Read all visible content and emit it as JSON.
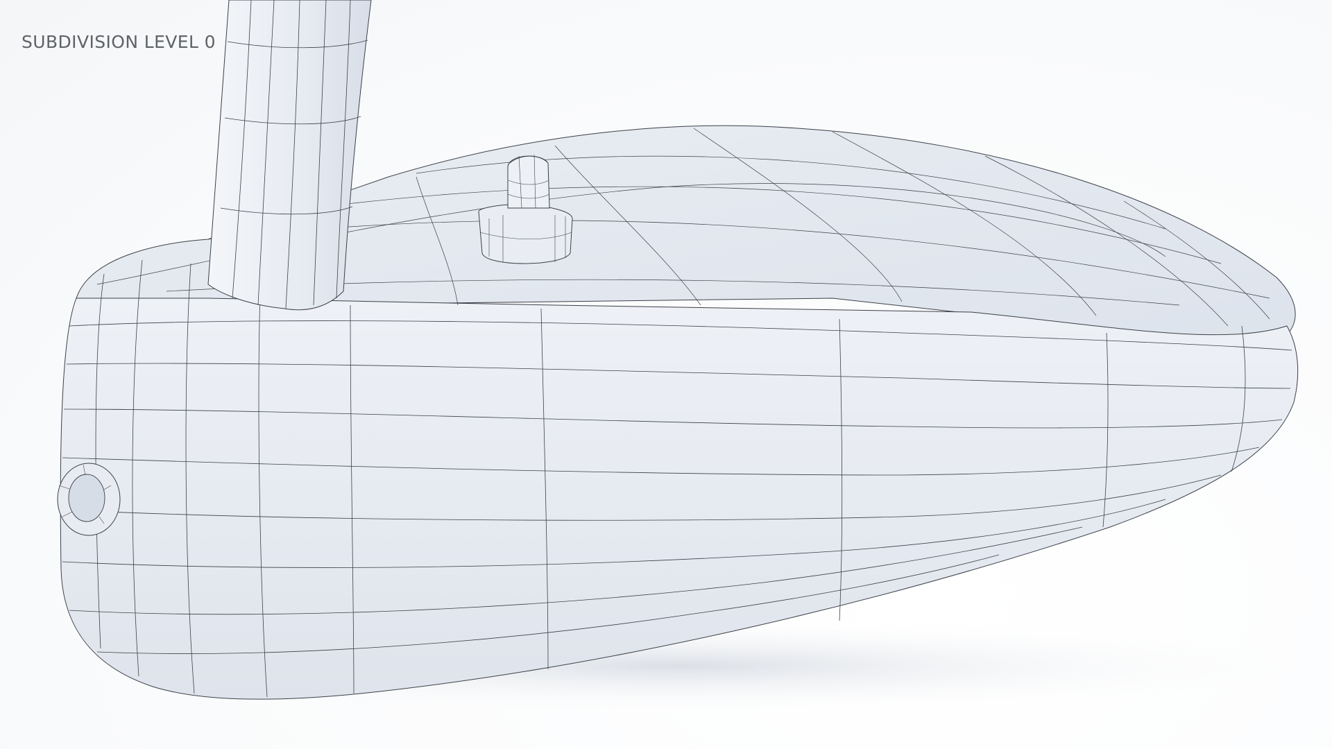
{
  "viewport": {
    "caption": "SUBDIVISION LEVEL 0"
  },
  "model": {
    "surface_color": "#e4e9f1",
    "shadow_color": "#c9d0dc",
    "wire_color": "#3a3f47",
    "background_color": "#ffffff"
  }
}
